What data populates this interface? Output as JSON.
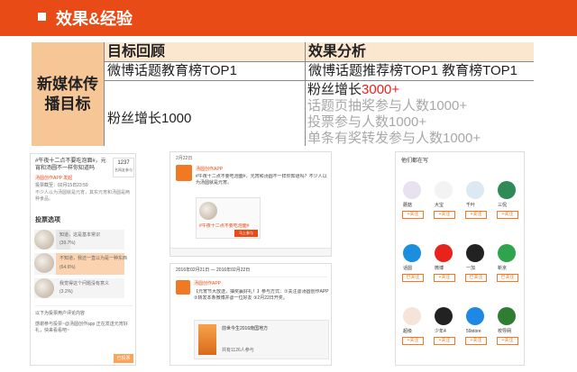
{
  "header": {
    "title": "效果&经验"
  },
  "table": {
    "row_label": "新媒体传播目标",
    "col1_title": "目标回顾",
    "col2_title": "效果分析",
    "col1_row1": "微博话题教育榜TOP1",
    "col2_row1": "微博话题推荐榜TOP1 教育榜TOP1",
    "col1_row2": "粉丝增长1000",
    "fans_label": "粉丝增长",
    "fans_value": "3000+",
    "bullets": [
      "话题页抽奖参与人数1000+",
      "投票参与人数1000+",
      "单条有奖转发参与人数1000+"
    ]
  },
  "colors": {
    "accent": "#e84b16",
    "red": "#e8231c",
    "gray": "#a8a8a8"
  },
  "shot1": {
    "title": "#午夜十二点不要吃泡面#，元宵和汤圆不一样你知道吗",
    "count": "1237",
    "count_label": "名网友参与",
    "account": "汤圆创作APP 发起",
    "meta": "投票截至：02月15日23:59",
    "desc": "不少人以为汤圆就是元宵，其实元宵和汤圆是两种食品。",
    "options_label": "投票选项",
    "options": [
      {
        "name": "知道，这是基本常识",
        "pct": "(39.7%)"
      },
      {
        "name": "不知道，我还一直以为是一种东西",
        "pct": "(64.6%)"
      },
      {
        "name": "我觉得这个问题没有意义",
        "pct": "(3.2%)"
      }
    ],
    "footer": "以下为投票用户评论内容",
    "footer2": "感谢参与投票~@汤圆创作app 正在发送元宵好礼，快来看看吧~",
    "footer_btn": "已投票"
  },
  "shot2": {
    "date": "2月22日",
    "account": "汤圆创作APP",
    "text": "#午夜十二点不要吃泡面#，元宵和汤圆不一样你知道吗？不少人以为汤圆就是元宵。",
    "card_title": "#午夜十二点不要吃泡面#",
    "card_btn": "马上参与"
  },
  "shot3": {
    "date_range": "2016年02月21日 — 2016年02月22日",
    "account": "汤圆创作APP",
    "text": "【元宵节大放送，抽奖赢好礼！】参与方式：①关注@汤圆创作APP ②转发本条微博并@一位好友 ③2月22日开奖。",
    "book_title": "前世今生2016南国地方",
    "book_meta": "共有1126人参与"
  },
  "shot4": {
    "title": "他们都在写",
    "users": [
      {
        "name": "蘑菇",
        "btn": "+关注"
      },
      {
        "name": "大宝",
        "btn": "+关注"
      },
      {
        "name": "千叶",
        "btn": "+关注"
      },
      {
        "name": "三侃",
        "btn": "+关注"
      },
      {
        "name": "话圆",
        "btn": "已关注"
      },
      {
        "name": "微博",
        "btn": "+关注"
      },
      {
        "name": "一加",
        "btn": "已关注"
      },
      {
        "name": "新京",
        "btn": "已关注"
      },
      {
        "name": "超级",
        "btn": "+关注"
      },
      {
        "name": "少年4",
        "btn": "+关注"
      },
      {
        "name": "59store",
        "btn": "+关注"
      },
      {
        "name": "校导网",
        "btn": "+关注"
      }
    ]
  }
}
